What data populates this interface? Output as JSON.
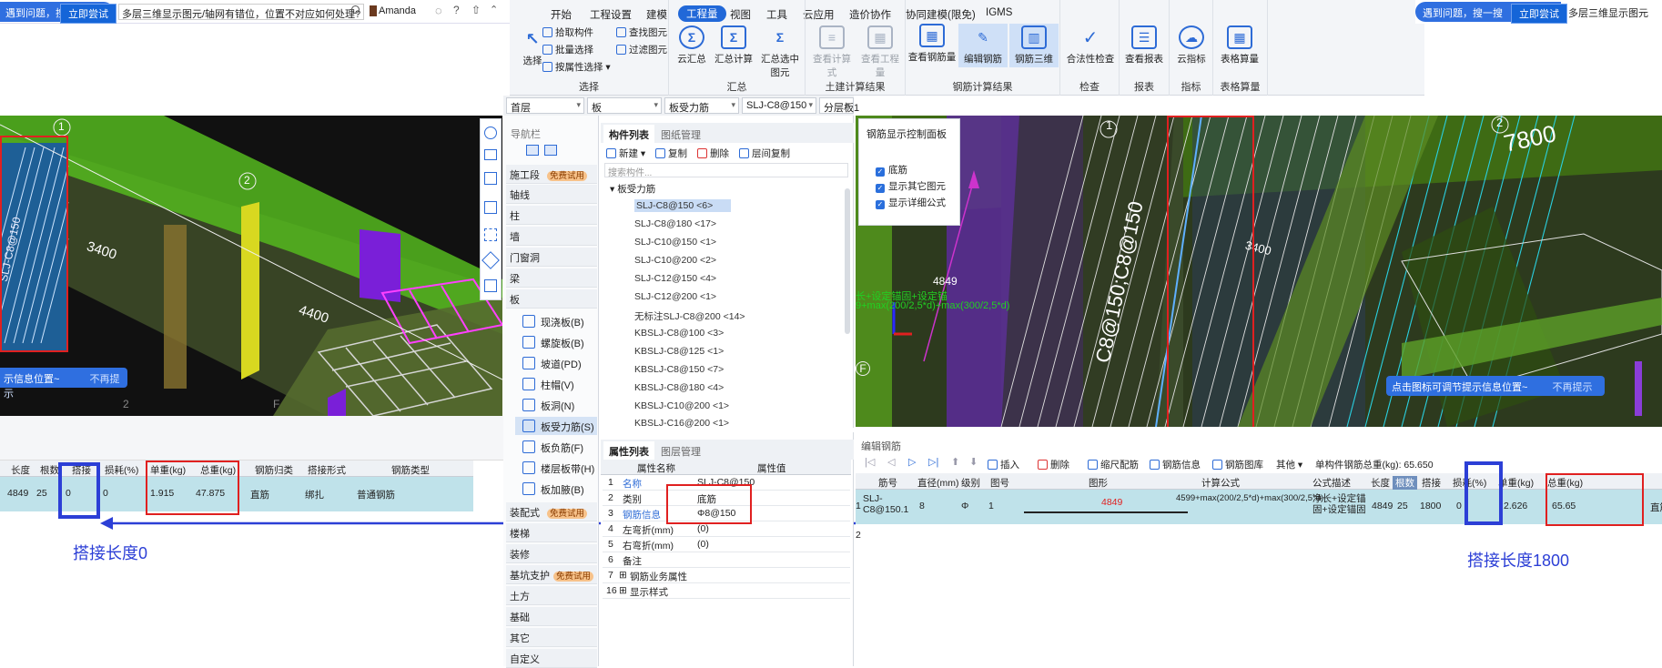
{
  "left_banner": {
    "text_prefix": "遇到问题，搜一搜",
    "button": "立即尝试",
    "question": "多层三维显示图元/轴网有错位，位置不对应如何处理?",
    "user": "Amanda"
  },
  "ribbon": {
    "tabs": [
      "开始",
      "工程设置",
      "建模",
      "工程量",
      "视图",
      "工具",
      "云应用",
      "造价协作",
      "协同建模(限免)",
      "IGMS"
    ],
    "active_tab": "工程量",
    "groups": {
      "select": {
        "title": "选择",
        "big": "选择",
        "small": [
          "拾取构件",
          "批量选择",
          "按属性选择",
          "查找图元",
          "过滤图元"
        ]
      },
      "summary": {
        "title": "汇总",
        "buttons": [
          "云汇总",
          "汇总计算",
          "汇总选中图元"
        ]
      },
      "civil": {
        "title": "土建计算结果",
        "buttons": [
          "查看计算式",
          "查看工程量"
        ]
      },
      "rebar": {
        "title": "钢筋计算结果",
        "buttons": [
          "查看钢筋量",
          "编辑钢筋",
          "钢筋三维"
        ]
      },
      "check": {
        "title": "检查",
        "buttons": [
          "合法性检查"
        ]
      },
      "report": {
        "title": "报表",
        "buttons": [
          "查看报表"
        ]
      },
      "index": {
        "title": "指标",
        "buttons": [
          "云指标"
        ]
      },
      "table": {
        "title": "表格算量",
        "buttons": [
          "表格算量"
        ]
      }
    }
  },
  "right_banner": {
    "text_prefix": "遇到问题，搜一搜",
    "button": "立即尝试",
    "question": "多层三维显示图元"
  },
  "filters": {
    "floor": "首层",
    "category": "板",
    "type": "板受力筋",
    "name": "SLJ-C8@150",
    "layer": "分层板1"
  },
  "nav": {
    "title": "导航栏",
    "items": [
      "施工段",
      "轴线",
      "柱",
      "墙",
      "门窗洞",
      "梁",
      "板"
    ],
    "free_badge": "免费试用",
    "sub_items": [
      "现浇板(B)",
      "螺旋板(B)",
      "坡道(PD)",
      "柱帽(V)",
      "板洞(N)",
      "板受力筋(S)",
      "板负筋(F)",
      "楼层板带(H)",
      "板加腋(B)"
    ],
    "bottom_items": [
      "装配式",
      "楼梯",
      "装修",
      "基坑支护",
      "土方",
      "基础",
      "其它",
      "自定义"
    ]
  },
  "component_list": {
    "tabs": [
      "构件列表",
      "图纸管理"
    ],
    "actions": [
      "新建",
      "复制",
      "删除",
      "层间复制"
    ],
    "search_placeholder": "搜索构件...",
    "root": "板受力筋",
    "items": [
      "SLJ-C8@150 <6>",
      "SLJ-C8@180 <17>",
      "SLJ-C10@150 <1>",
      "SLJ-C10@200 <2>",
      "SLJ-C12@150 <4>",
      "SLJ-C12@200 <1>",
      "无标注SLJ-C8@200 <14>",
      "KBSLJ-C8@100 <3>",
      "KBSLJ-C8@125 <1>",
      "KBSLJ-C8@150 <7>",
      "KBSLJ-C8@180 <4>",
      "KBSLJ-C10@200 <1>",
      "KBSLJ-C16@200 <1>"
    ]
  },
  "property_list": {
    "tabs": [
      "属性列表",
      "图层管理"
    ],
    "headers": [
      "属性名称",
      "属性值"
    ],
    "rows": [
      {
        "n": "1",
        "name": "名称",
        "value": "SLJ-C8@150"
      },
      {
        "n": "2",
        "name": "类别",
        "value": "底筋"
      },
      {
        "n": "3",
        "name": "钢筋信息",
        "value": "Φ8@150"
      },
      {
        "n": "4",
        "name": "左弯折(mm)",
        "value": "(0)"
      },
      {
        "n": "5",
        "name": "右弯折(mm)",
        "value": "(0)"
      },
      {
        "n": "6",
        "name": "备注",
        "value": ""
      },
      {
        "n": "7",
        "name": "钢筋业务属性",
        "value": ""
      },
      {
        "n": "16",
        "name": "显示样式",
        "value": ""
      }
    ]
  },
  "left_viewport": {
    "axis_1": "1",
    "axis_2": "2",
    "dim_a": "3400",
    "dim_b": "4400",
    "rebar_label": "SLJ-C8@150",
    "hint": "示信息位置~",
    "hint_btn": "不再提示",
    "bottom_2": "2",
    "bottom_f": "F"
  },
  "right_viewport": {
    "axis_1": "1",
    "axis_2": "2",
    "dim_top": "7800",
    "dim_mid": "3400",
    "dim_4849": "4849",
    "rebar_label": "C8@150;C8@150",
    "formula_a": "长+设定锚固+设定锚",
    "formula_b": "9+max(200/2,5*d)+max(300/2,5*d)",
    "hint": "点击图标可调节提示信息位置~",
    "hint_btn": "不再提示",
    "axis_f": "F"
  },
  "rebar_panel": {
    "title": "钢筋显示控制面板",
    "options": [
      "底筋",
      "显示其它图元",
      "显示详细公式"
    ]
  },
  "left_grid": {
    "headers": [
      "长度",
      "根数",
      "搭接",
      "损耗(%)",
      "单重(kg)",
      "总重(kg)",
      "钢筋归类",
      "搭接形式",
      "钢筋类型"
    ],
    "row": [
      "4849",
      "25",
      "0",
      "0",
      "1.915",
      "47.875",
      "直筋",
      "绑扎",
      "普通钢筋"
    ]
  },
  "right_grid": {
    "title": "编辑钢筋",
    "actions": [
      "插入",
      "删除",
      "缩尺配筋",
      "钢筋信息",
      "钢筋图库",
      "其他"
    ],
    "total": "单构件钢筋总重(kg): 65.650",
    "headers": [
      "筋号",
      "直径(mm)",
      "级别",
      "图号",
      "图形",
      "计算公式",
      "公式描述",
      "长度",
      "根数",
      "搭接",
      "损耗(%)",
      "单重(kg)",
      "总重(kg)"
    ],
    "row": {
      "n": "1",
      "name": "SLJ-C8@150.1",
      "diameter": "8",
      "grade": "Φ",
      "fig": "1",
      "shape_len": "4849",
      "formula": "4599+max(200/2,5*d)+max(300/2,5*d)",
      "desc": "净长+设定锚固+设定锚固",
      "length": "4849",
      "count": "25",
      "lap": "1800",
      "loss": "0",
      "unit": "2.626",
      "total": "65.65",
      "type": "直筋"
    },
    "row2_n": "2"
  },
  "annotations": {
    "left": "搭接长度0",
    "right": "搭接长度1800"
  }
}
